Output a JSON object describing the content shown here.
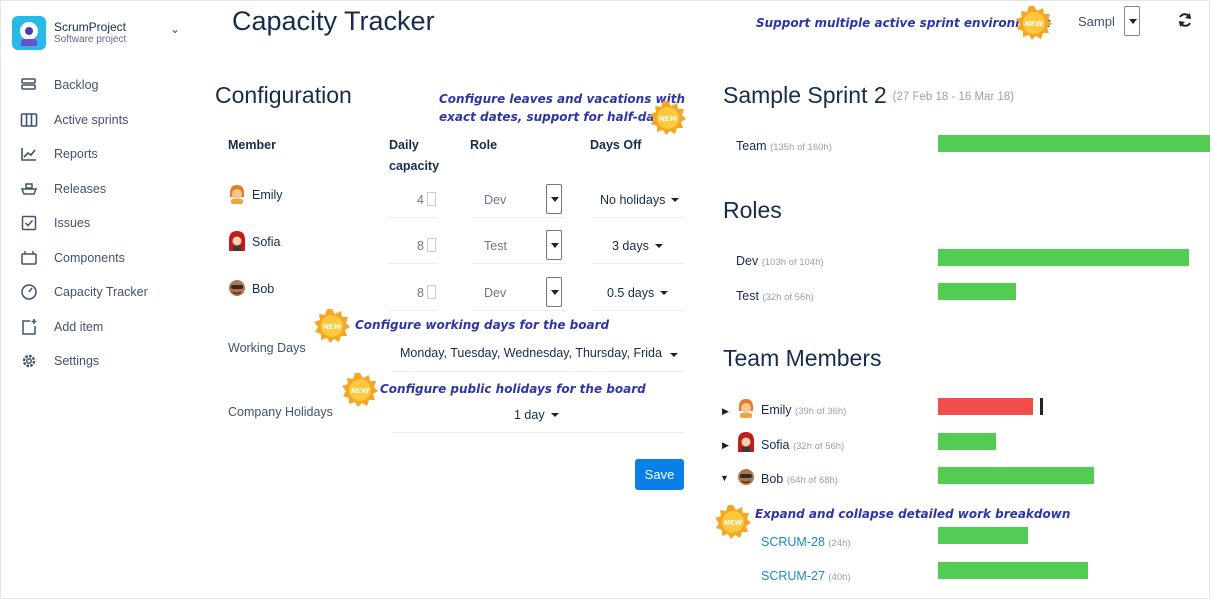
{
  "project": {
    "name": "ScrumProject",
    "type": "Software project"
  },
  "sidebar": {
    "items": [
      {
        "label": "Backlog",
        "icon": "backlog-icon"
      },
      {
        "label": "Active sprints",
        "icon": "board-icon"
      },
      {
        "label": "Reports",
        "icon": "chart-icon"
      },
      {
        "label": "Releases",
        "icon": "ship-icon"
      },
      {
        "label": "Issues",
        "icon": "issues-icon"
      },
      {
        "label": "Components",
        "icon": "components-icon"
      },
      {
        "label": "Capacity Tracker",
        "icon": "gauge-icon"
      },
      {
        "label": "Add item",
        "icon": "add-item-icon"
      },
      {
        "label": "Settings",
        "icon": "gear-icon"
      }
    ]
  },
  "header": {
    "title": "Capacity Tracker",
    "sprint_select": "Sampl"
  },
  "config": {
    "title": "Configuration",
    "columns": {
      "member": "Member",
      "daily1": "Daily",
      "daily2": "capacity",
      "role": "Role",
      "days_off": "Days Off"
    },
    "members": [
      {
        "name": "Emily",
        "capacity": "4",
        "role": "Dev",
        "days_off": "No holidays"
      },
      {
        "name": "Sofia",
        "capacity": "8",
        "role": "Test",
        "days_off": "3 days"
      },
      {
        "name": "Bob",
        "capacity": "8",
        "role": "Dev",
        "days_off": "0.5 days"
      }
    ],
    "working_days_label": "Working Days",
    "working_days_value": "Monday, Tuesday, Wednesday, Thursday, Friday",
    "company_holidays_label": "Company Holidays",
    "company_holidays_value": "1 day",
    "save_label": "Save"
  },
  "notes": {
    "multi_sprint": "Support multiple active sprint environment",
    "leaves_1": "Configure leaves and vacations with",
    "leaves_2": "exact dates, support for half-days",
    "working_days": "Configure working days for the board",
    "holidays": "Configure public holidays for the board",
    "expand": "Expand and collapse detailed work breakdown",
    "badge_text": "NEW"
  },
  "sprint": {
    "title": "Sample Sprint 2",
    "range": "(27 Feb 18 - 16 Mar 18)",
    "team": {
      "label": "Team",
      "detail": "(135h of 160h)",
      "used_h": 135,
      "total_h": 160
    }
  },
  "roles": {
    "title": "Roles",
    "items": [
      {
        "label": "Dev",
        "detail": "(103h of 104h)",
        "used_h": 103,
        "total_h": 104
      },
      {
        "label": "Test",
        "detail": "(32h of 56h)",
        "used_h": 32,
        "total_h": 56
      }
    ]
  },
  "team_members": {
    "title": "Team Members",
    "items": [
      {
        "label": "Emily",
        "detail": "(39h of 36h)",
        "used_h": 39,
        "total_h": 36,
        "over": true,
        "expanded": false
      },
      {
        "label": "Sofia",
        "detail": "(32h of 56h)",
        "used_h": 32,
        "total_h": 56,
        "over": false,
        "expanded": false
      },
      {
        "label": "Bob",
        "detail": "(64h of 68h)",
        "used_h": 64,
        "total_h": 68,
        "over": false,
        "expanded": true
      }
    ],
    "issues": [
      {
        "key": "SCRUM-28",
        "detail": "(24h)",
        "hours": 24
      },
      {
        "key": "SCRUM-27",
        "detail": "(40h)",
        "hours": 40
      }
    ]
  },
  "colors": {
    "ok": "#52cc52",
    "over": "#f44b4b",
    "accent": "#0c7fe6",
    "note": "#2f35a6"
  }
}
